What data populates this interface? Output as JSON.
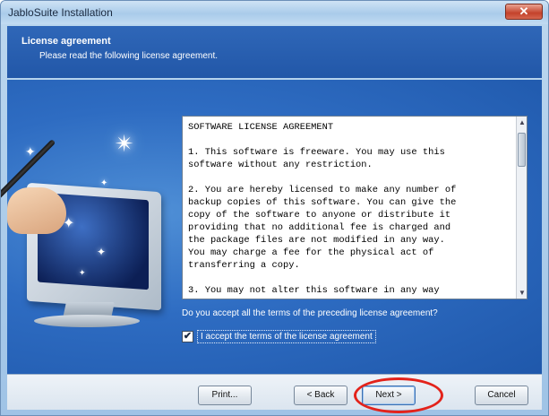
{
  "window": {
    "title": "JabloSuite Installation",
    "close_glyph": "✕"
  },
  "header": {
    "title": "License agreement",
    "subtitle": "Please read the following license agreement."
  },
  "license": {
    "text": "SOFTWARE LICENSE AGREEMENT\n\n1. This software is freeware. You may use this\nsoftware without any restriction.\n\n2. You are hereby licensed to make any number of\nbackup copies of this software. You can give the\ncopy of the software to anyone or distribute it\nproviding that no additional fee is charged and\nthe package files are not modified in any way.\nYou may charge a fee for the physical act of\ntransferring a copy.\n\n3. You may not alter this software in any way"
  },
  "question": "Do you accept all the terms of the preceding license agreement?",
  "accept": {
    "label": "I accept the terms of the license agreement",
    "checked": true,
    "check_glyph": "✔"
  },
  "buttons": {
    "print": "Print...",
    "back": "< Back",
    "next": "Next >",
    "cancel": "Cancel"
  },
  "icons": {
    "close": "close-icon",
    "scroll_up": "scroll-up-arrow-icon",
    "scroll_down": "scroll-down-arrow-icon",
    "wand": "magic-wand-icon",
    "monitor": "monitor-icon"
  },
  "colors": {
    "header_blue": "#2f67b8",
    "content_blue": "#2e6cc2",
    "highlight_red": "#e3231b"
  }
}
